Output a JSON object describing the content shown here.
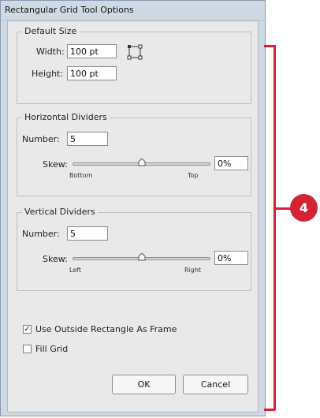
{
  "dialog": {
    "title": "Rectangular Grid Tool Options",
    "default_size": {
      "legend": "Default Size",
      "width_label": "Width:",
      "width_value": "100 pt",
      "height_label": "Height:",
      "height_value": "100 pt",
      "reference_icon": "origin-point-icon"
    },
    "horizontal_dividers": {
      "legend": "Horizontal Dividers",
      "number_label": "Number:",
      "number_value": "5",
      "skew_label": "Skew:",
      "skew_value": "0%",
      "skew_level": 0.5,
      "min_label": "Bottom",
      "max_label": "Top"
    },
    "vertical_dividers": {
      "legend": "Vertical Dividers",
      "number_label": "Number:",
      "number_value": "5",
      "skew_label": "Skew:",
      "skew_value": "0%",
      "skew_level": 0.5,
      "min_label": "Left",
      "max_label": "Right"
    },
    "use_outside_rectangle": {
      "label": "Use Outside Rectangle As Frame",
      "checked": true,
      "mark": "✓"
    },
    "fill_grid": {
      "label": "Fill Grid",
      "checked": false
    },
    "ok_label": "OK",
    "cancel_label": "Cancel"
  },
  "annotation": {
    "number": "4",
    "color": "#d32333"
  }
}
